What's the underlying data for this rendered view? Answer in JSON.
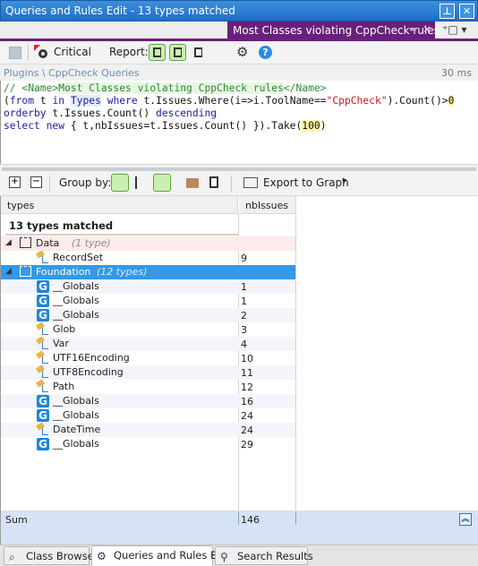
{
  "window": {
    "title": "Queries and Rules Edit  - 13 types matched",
    "pin_label": "⊥",
    "close_label": "✕"
  },
  "doc_tab": {
    "label": "Most Classes violating CppCheck rules",
    "pin_glyph": "▬",
    "close_glyph": "✕",
    "new_tab_glyph": "⁺□ ▾"
  },
  "toolbar": {
    "critical_label": "Critical",
    "report_label": "Report:",
    "gear_glyph": "⚙",
    "help_glyph": "?"
  },
  "query": {
    "breadcrumb": "Plugins \\ CppCheck Queries",
    "duration": "30 ms",
    "code": {
      "line1_comment_prefix": "// ",
      "line1_name_open": "<Name>",
      "line1_name": "Most Classes violating CppCheck rules",
      "line1_name_close": "</Name>",
      "line2_a": "(",
      "line2_from": "from",
      "line2_b": " t ",
      "line2_in": "in",
      "line2_sp": " ",
      "line2_types": "Types",
      "line2_sp2": " ",
      "line2_where": "where",
      "line2_c": " t.Issues.Where(i=>i.ToolName==",
      "line2_str": "\"CppCheck\"",
      "line2_d": ").Count()>",
      "line2_num": "0",
      "line3_orderby": "orderby",
      "line3_a": " t.Issues.Count() ",
      "line3_desc": "descending",
      "line4_select": "select",
      "line4_sp": " ",
      "line4_new": "new",
      "line4_a": " { t,nbIssues=t.Issues.Count() }).Take(",
      "line4_num": "100",
      "line4_b": ")"
    }
  },
  "results_toolbar": {
    "expand_glyph": "+",
    "collapse_glyph": "−",
    "group_by_label": "Group by:",
    "export_label": "Export to Graph",
    "export_dropdown_glyph": "▾"
  },
  "grid": {
    "columns": [
      "types",
      "nbIssues"
    ],
    "matched_label": "13 types matched",
    "groups": [
      {
        "name": "Data",
        "count_label": "(1 type)",
        "expander": "◢",
        "items": [
          {
            "icon": "class",
            "name": "RecordSet",
            "nbIssues": "9"
          }
        ]
      },
      {
        "name": "Foundation",
        "count_label": "(12 types)",
        "expander": "◢",
        "items": [
          {
            "icon": "globals",
            "name": "__Globals",
            "nbIssues": "1"
          },
          {
            "icon": "globals",
            "name": "__Globals",
            "nbIssues": "1"
          },
          {
            "icon": "globals",
            "name": "__Globals",
            "nbIssues": "2"
          },
          {
            "icon": "class",
            "name": "Glob",
            "nbIssues": "3"
          },
          {
            "icon": "class",
            "name": "Var",
            "nbIssues": "4"
          },
          {
            "icon": "class",
            "name": "UTF16Encoding",
            "nbIssues": "10"
          },
          {
            "icon": "class",
            "name": "UTF8Encoding",
            "nbIssues": "11"
          },
          {
            "icon": "class",
            "name": "Path",
            "nbIssues": "12"
          },
          {
            "icon": "globals",
            "name": "__Globals",
            "nbIssues": "16"
          },
          {
            "icon": "globals",
            "name": "__Globals",
            "nbIssues": "24"
          },
          {
            "icon": "class",
            "name": "DateTime",
            "nbIssues": "24"
          },
          {
            "icon": "globals",
            "name": "__Globals",
            "nbIssues": "29"
          }
        ]
      }
    ],
    "globals_glyph": "G",
    "sum_label": "Sum",
    "sum_value": "146",
    "collapse_glyph": "︽"
  },
  "bottom_tabs": [
    {
      "label": "Class Browser",
      "glyph": "⌕",
      "active": false
    },
    {
      "label": "Queries and Rules Edit",
      "glyph": "⚙",
      "active": true
    },
    {
      "label": "Search Results",
      "glyph": "⚲",
      "active": false
    }
  ],
  "colors": {
    "title_bar": "#1f6ec8",
    "doc_tab": "#68217a",
    "selected_row": "#3399e8",
    "sum_bar": "#d6e3f7"
  }
}
